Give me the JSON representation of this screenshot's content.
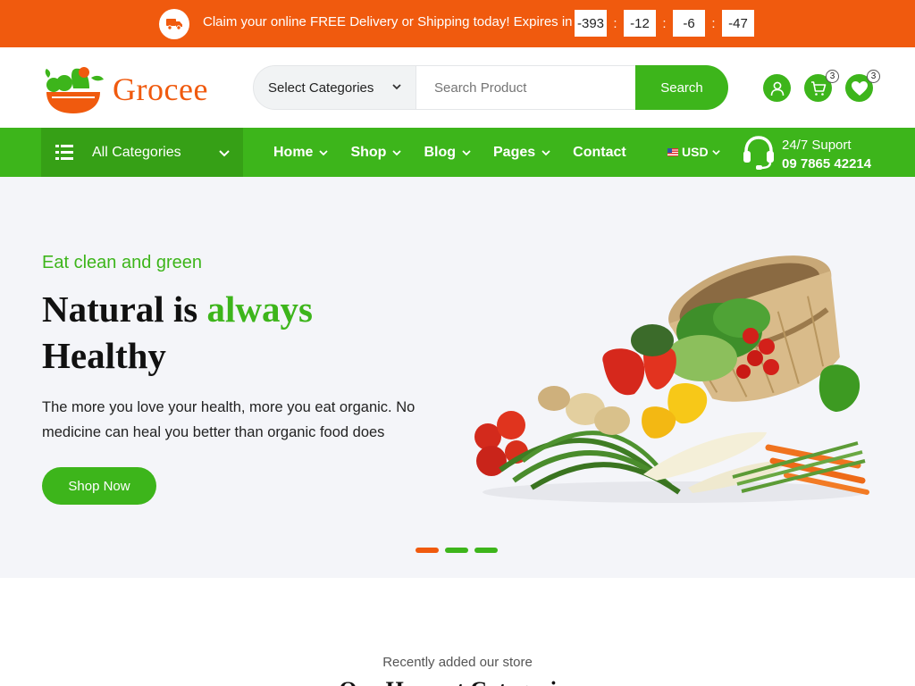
{
  "promo": {
    "text": "Claim your online FREE Delivery or Shipping today! Expires in",
    "timer": [
      "-393",
      "-12",
      "-6",
      "-47"
    ],
    "separator": ":"
  },
  "header": {
    "logo_text": "Grocee",
    "category_select": "Select Categories",
    "search_placeholder": "Search Product",
    "search_button": "Search",
    "cart_count": "3",
    "wishlist_count": "3",
    "icons": [
      "user-icon",
      "cart-icon",
      "heart-icon"
    ]
  },
  "nav": {
    "all_categories": "All Categories",
    "menu": [
      {
        "label": "Home",
        "has_dropdown": true
      },
      {
        "label": "Shop",
        "has_dropdown": true
      },
      {
        "label": "Blog",
        "has_dropdown": true
      },
      {
        "label": "Pages",
        "has_dropdown": true
      },
      {
        "label": "Contact",
        "has_dropdown": false
      }
    ],
    "currency": "USD",
    "support_label": "24/7 Suport",
    "support_phone": "09 7865 42214"
  },
  "hero": {
    "subtitle": "Eat clean and green",
    "title_part1": "Natural is ",
    "title_accent": "always",
    "title_part2": "Healthy",
    "description": "The more you love your health, more you eat organic. No medicine can heal you better than organic food does",
    "button": "Shop Now",
    "slides": 3,
    "active_slide": 0
  },
  "section": {
    "subtitle": "Recently added our store",
    "title": "Our Harvest Categories"
  },
  "colors": {
    "orange": "#f05a0e",
    "green": "#3db51b",
    "green_dark": "#36a016",
    "hero_bg": "#f4f5f9"
  }
}
